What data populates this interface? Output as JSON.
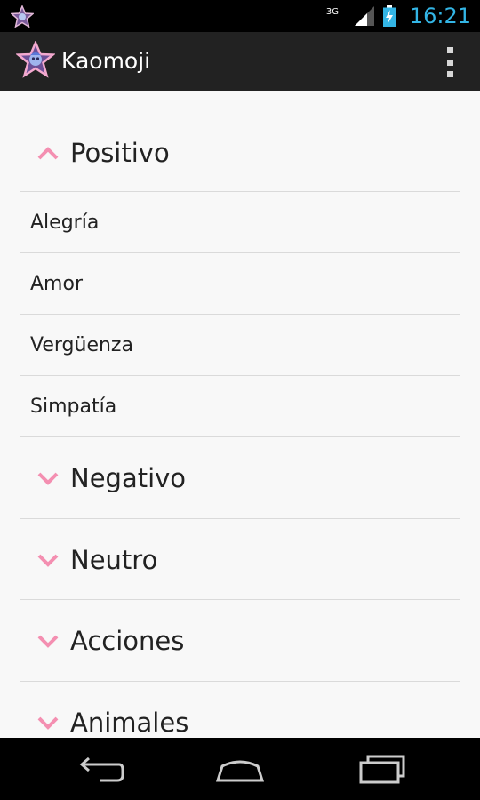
{
  "status_bar": {
    "network_type": "3G",
    "time": "16:21",
    "icons": [
      "app-notification-icon",
      "signal-icon",
      "battery-charging-icon"
    ]
  },
  "action_bar": {
    "title": "Kaomoji",
    "icons": [
      "app-logo-icon",
      "overflow-menu-icon"
    ]
  },
  "groups": [
    {
      "label": "Positivo",
      "expanded": true,
      "items": [
        "Alegría",
        "Amor",
        "Vergüenza",
        "Simpatía"
      ]
    },
    {
      "label": "Negativo",
      "expanded": false
    },
    {
      "label": "Neutro",
      "expanded": false
    },
    {
      "label": "Acciones",
      "expanded": false
    },
    {
      "label": "Animales",
      "expanded": false
    }
  ],
  "nav_bar": {
    "icons": [
      "back-icon",
      "home-icon",
      "recent-apps-icon"
    ]
  },
  "colors": {
    "accent_pink": "#f48fb1",
    "clock_blue": "#33b5e5",
    "action_bar": "#222222",
    "list_background": "#f8f8f8"
  }
}
